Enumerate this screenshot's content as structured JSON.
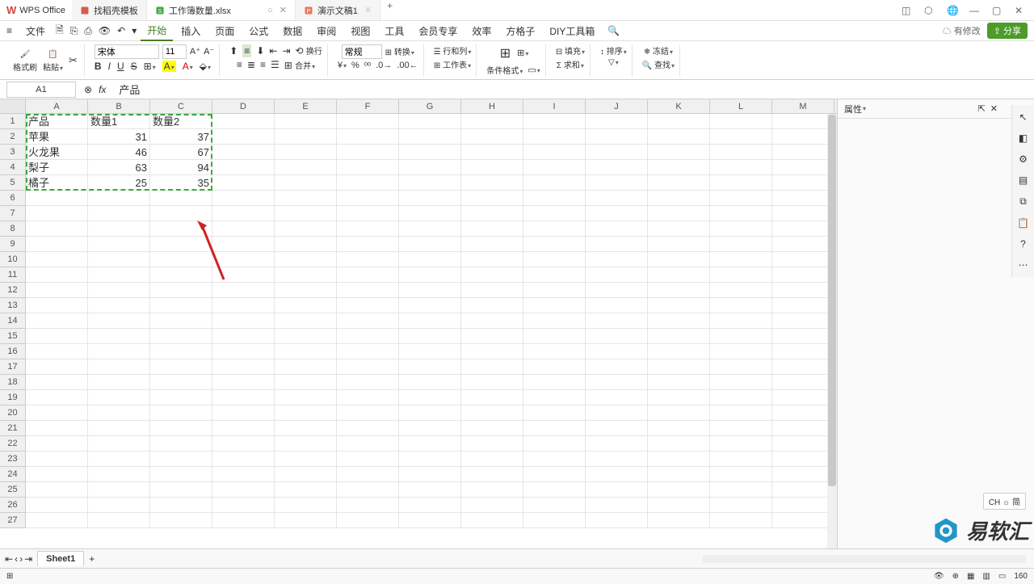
{
  "app": {
    "name": "WPS Office"
  },
  "tabs": [
    {
      "label": "找稻壳模板",
      "active": false
    },
    {
      "label": "工作簿数量.xlsx",
      "active": true,
      "modified": true
    },
    {
      "label": "演示文稿1",
      "active": false
    }
  ],
  "menubar": {
    "file": "文件",
    "items": [
      "开始",
      "插入",
      "页面",
      "公式",
      "数据",
      "审阅",
      "视图",
      "工具",
      "会员专享",
      "效率",
      "方格子",
      "DIY工具箱"
    ],
    "active_index": 0,
    "changes": "有修改",
    "share": "分享"
  },
  "ribbon": {
    "format_painter": "格式刷",
    "paste": "粘贴",
    "font_name": "宋体",
    "font_size": "11",
    "wrap": "换行",
    "merge": "合并",
    "number_format": "常规",
    "convert": "转换",
    "row_col": "行和列",
    "worksheet": "工作表",
    "cond_format": "条件格式",
    "fill": "填充",
    "sort": "排序",
    "freeze": "冻结",
    "sum": "求和",
    "find": "查找"
  },
  "formula_bar": {
    "name_box": "A1",
    "formula": "产品"
  },
  "columns": [
    "A",
    "B",
    "C",
    "D",
    "E",
    "F",
    "G",
    "H",
    "I",
    "J",
    "K",
    "L",
    "M"
  ],
  "row_count": 27,
  "chart_data": {
    "type": "table",
    "headers": [
      "产品",
      "数量1",
      "数量2"
    ],
    "rows": [
      [
        "苹果",
        31,
        37
      ],
      [
        "火龙果",
        46,
        67
      ],
      [
        "梨子",
        63,
        94
      ],
      [
        "橘子",
        25,
        35
      ]
    ]
  },
  "selection": {
    "range": "A1:C5"
  },
  "side_panel": {
    "title": "属性"
  },
  "sheet": {
    "name": "Sheet1"
  },
  "status": {
    "zoom": "160",
    "ime": "CH ☼ 简"
  },
  "watermark": "易软汇"
}
